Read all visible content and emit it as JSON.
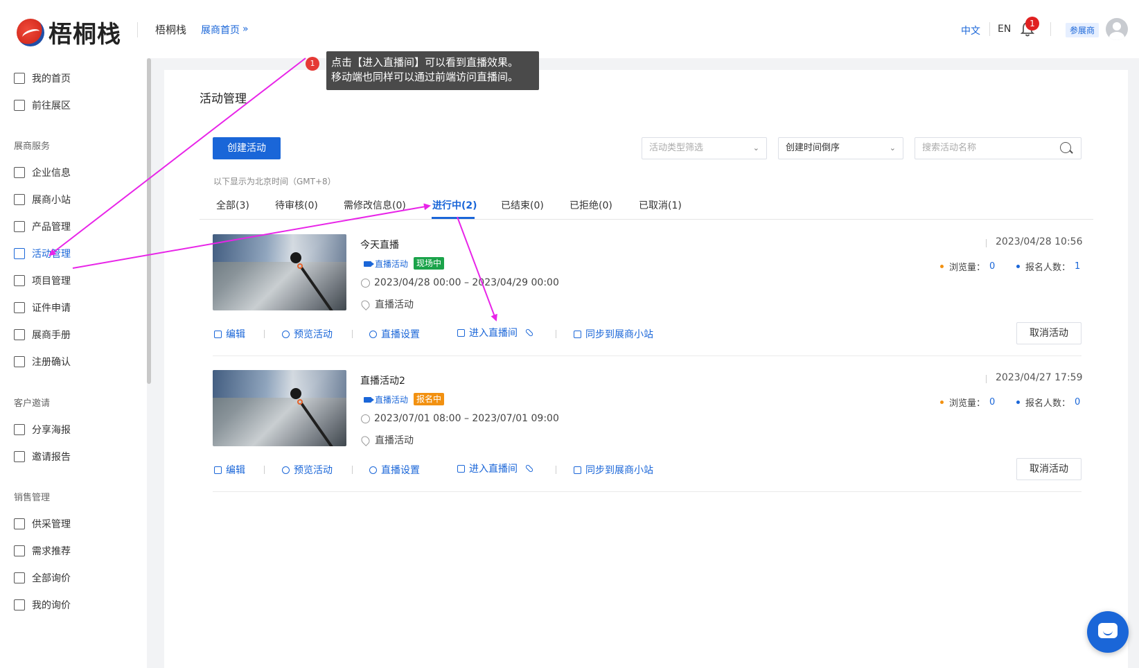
{
  "header": {
    "logo_text": "梧桐栈",
    "site_name": "梧桐栈",
    "home_link": "展商首页",
    "lang_zh": "中文",
    "lang_en": "EN",
    "notification_count": "1",
    "role_badge": "参展商"
  },
  "sidebar": {
    "items": [
      {
        "label": "我的首页",
        "icon": "home-icon"
      },
      {
        "label": "前往展区",
        "icon": "booth-icon"
      }
    ],
    "section_1": "展商服务",
    "items_1": [
      {
        "label": "企业信息",
        "icon": "building-icon"
      },
      {
        "label": "展商小站",
        "icon": "store-icon"
      },
      {
        "label": "产品管理",
        "icon": "grid-icon"
      },
      {
        "label": "活动管理",
        "icon": "calendar-icon",
        "active": true
      },
      {
        "label": "项目管理",
        "icon": "folder-icon"
      },
      {
        "label": "证件申请",
        "icon": "id-card-icon"
      },
      {
        "label": "展商手册",
        "icon": "manual-icon"
      },
      {
        "label": "注册确认",
        "icon": "confirm-icon"
      }
    ],
    "section_2": "客户邀请",
    "items_2": [
      {
        "label": "分享海报",
        "icon": "poster-icon"
      },
      {
        "label": "邀请报告",
        "icon": "report-icon"
      }
    ],
    "section_3": "销售管理",
    "items_3": [
      {
        "label": "供采管理",
        "icon": "database-icon"
      },
      {
        "label": "需求推荐",
        "icon": "recommend-icon"
      },
      {
        "label": "全部询价",
        "icon": "inquiry-icon"
      },
      {
        "label": "我的询价",
        "icon": "my-inquiry-icon"
      }
    ]
  },
  "main": {
    "page_title": "活动管理",
    "create_button": "创建活动",
    "type_filter_placeholder": "活动类型筛选",
    "sort_value": "创建时间倒序",
    "search_placeholder": "搜索活动名称",
    "timezone_note": "以下显示为北京时间（GMT+8）",
    "tabs": [
      {
        "label": "全部(3)"
      },
      {
        "label": "待审核(0)"
      },
      {
        "label": "需修改信息(0)"
      },
      {
        "label": "进行中(2)",
        "active": true
      },
      {
        "label": "已结束(0)"
      },
      {
        "label": "已拒绝(0)"
      },
      {
        "label": "已取消(1)"
      }
    ],
    "activities": [
      {
        "title": "今天直播",
        "type": "直播活动",
        "status": "现场中",
        "status_color": "#1ba34a",
        "time": "2023/04/28 00:00 – 2023/04/29 00:00",
        "place": "直播活动",
        "created": "2023/04/28 10:56",
        "views_label": "浏览量：",
        "views": "0",
        "signups_label": "报名人数：",
        "signups": "1"
      },
      {
        "title": "直播活动2",
        "type": "直播活动",
        "status": "报名中",
        "status_color": "#f29111",
        "time": "2023/07/01 08:00 – 2023/07/01 09:00",
        "place": "直播活动",
        "created": "2023/04/27 17:59",
        "views_label": "浏览量：",
        "views": "0",
        "signups_label": "报名人数：",
        "signups": "0"
      }
    ],
    "actions": {
      "edit": "编辑",
      "preview": "预览活动",
      "live_settings": "直播设置",
      "enter_live": "进入直播间",
      "sync": "同步到展商小站",
      "cancel": "取消活动"
    }
  },
  "annotation": {
    "step": "1",
    "line1": "点击【进入直播间】可以看到直播效果。",
    "line2": "移动端也同样可以通过前端访问直播间。"
  },
  "colors": {
    "primary": "#1a66d8",
    "annotation_arrow": "#e824e8",
    "views_dot": "#f29111",
    "signups_dot": "#1a66d8"
  }
}
